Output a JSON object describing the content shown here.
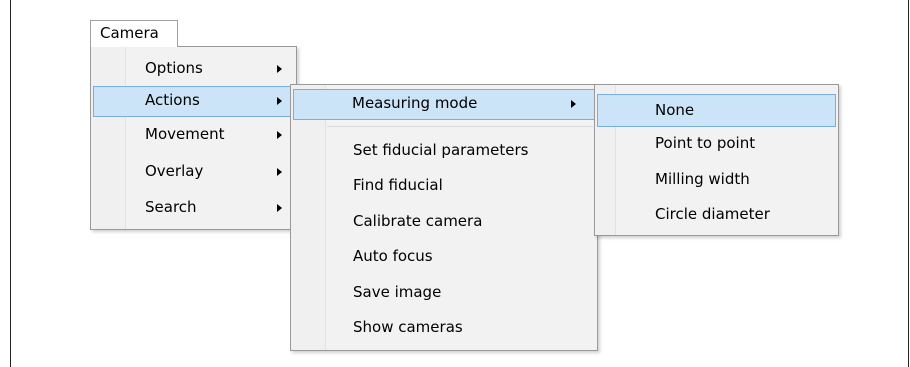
{
  "menubar": {
    "camera_label": "Camera"
  },
  "camera_menu": {
    "items": [
      {
        "label": "Options",
        "submenu": true
      },
      {
        "label": "Actions",
        "submenu": true,
        "highlighted": true
      },
      {
        "label": "Movement",
        "submenu": true
      },
      {
        "label": "Overlay",
        "submenu": true
      },
      {
        "label": "Search",
        "submenu": true
      }
    ]
  },
  "actions_menu": {
    "items": [
      {
        "label": "Measuring mode",
        "submenu": true,
        "highlighted": true
      },
      {
        "label": "Set fiducial parameters"
      },
      {
        "label": "Find fiducial"
      },
      {
        "label": "Calibrate camera"
      },
      {
        "label": "Auto focus"
      },
      {
        "label": "Save image"
      },
      {
        "label": "Show cameras"
      }
    ]
  },
  "measuring_mode_menu": {
    "items": [
      {
        "label": "None",
        "highlighted": true
      },
      {
        "label": "Point to point"
      },
      {
        "label": "Milling width"
      },
      {
        "label": "Circle diameter"
      }
    ]
  },
  "colors": {
    "highlight_bg": "#cce4f7",
    "highlight_border": "#7aaee0",
    "menu_bg": "#f2f2f2"
  }
}
